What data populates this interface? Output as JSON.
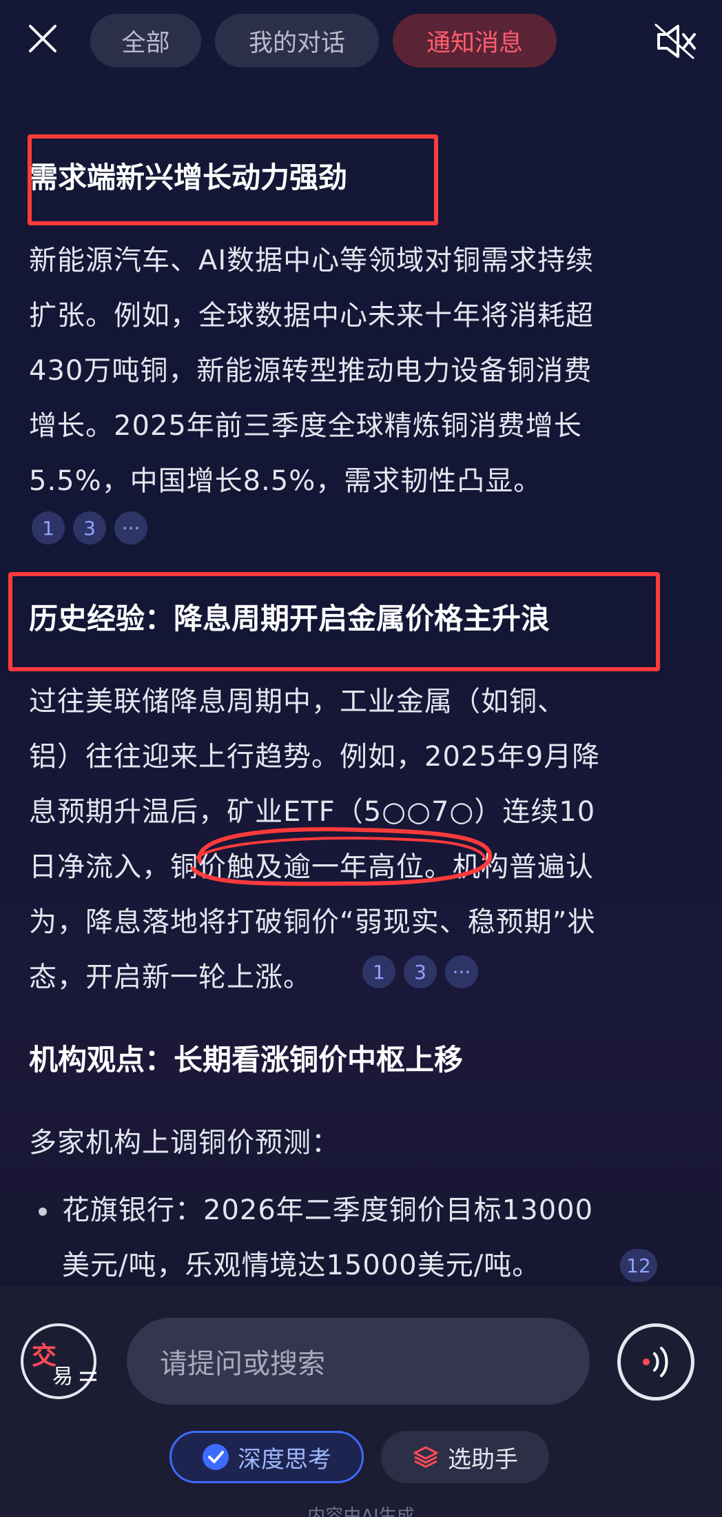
{
  "header": {
    "tabs": [
      {
        "label": "全部",
        "active": false
      },
      {
        "label": "我的对话",
        "active": false
      },
      {
        "label": "通知消息",
        "active": true
      }
    ],
    "close_icon": "close-icon",
    "mute_icon": "speaker-muted-icon"
  },
  "sections": [
    {
      "heading": "需求端新兴增长动力强劲",
      "lines": [
        "新能源汽车、AI数据中心等领域对铜需求持续",
        "扩张。例如，全球数据中心未来十年将消耗超",
        "430万吨铜，新能源转型推动电力设备铜消费",
        "增长。2025年前三季度全球精炼铜消费增长",
        "5.5%，中国增长8.5%，需求韧性凸显。"
      ],
      "refs": [
        "1",
        "3",
        "···"
      ]
    },
    {
      "heading": "历史经验：降息周期开启金属价格主升浪",
      "lines": [
        "过往美联储降息周期中，工业金属（如铜、",
        "铝）往往迎来上行趋势。例如，2025年9月降",
        "息预期升温后，矿业ETF（5○○7○）连续10",
        "日净流入，铜价触及逾一年高位。机构普遍认",
        "为，降息落地将打破铜价“弱现实、稳预期”状",
        "态，开启新一轮上涨。"
      ],
      "refs": [
        "1",
        "3",
        "···"
      ]
    },
    {
      "heading": "机构观点：长期看涨铜价中枢上移",
      "intro": "多家机构上调铜价预测：",
      "bullets": [
        {
          "lines": [
            "花旗银行：2026年二季度铜价目标13000",
            "美元/吨，乐观情境达15000美元/吨。"
          ],
          "ref": "12"
        }
      ]
    }
  ],
  "composer": {
    "logo_chars": [
      "交",
      "易"
    ],
    "placeholder": "请提问或搜索",
    "chips": [
      {
        "label": "深度思考",
        "icon": "check-circle-icon",
        "active": true
      },
      {
        "label": "选助手",
        "icon": "layers-icon",
        "active": false
      }
    ],
    "footer_note": "内容由AI生成"
  },
  "annotations": {
    "highlight_color": "#ff3b3b"
  }
}
